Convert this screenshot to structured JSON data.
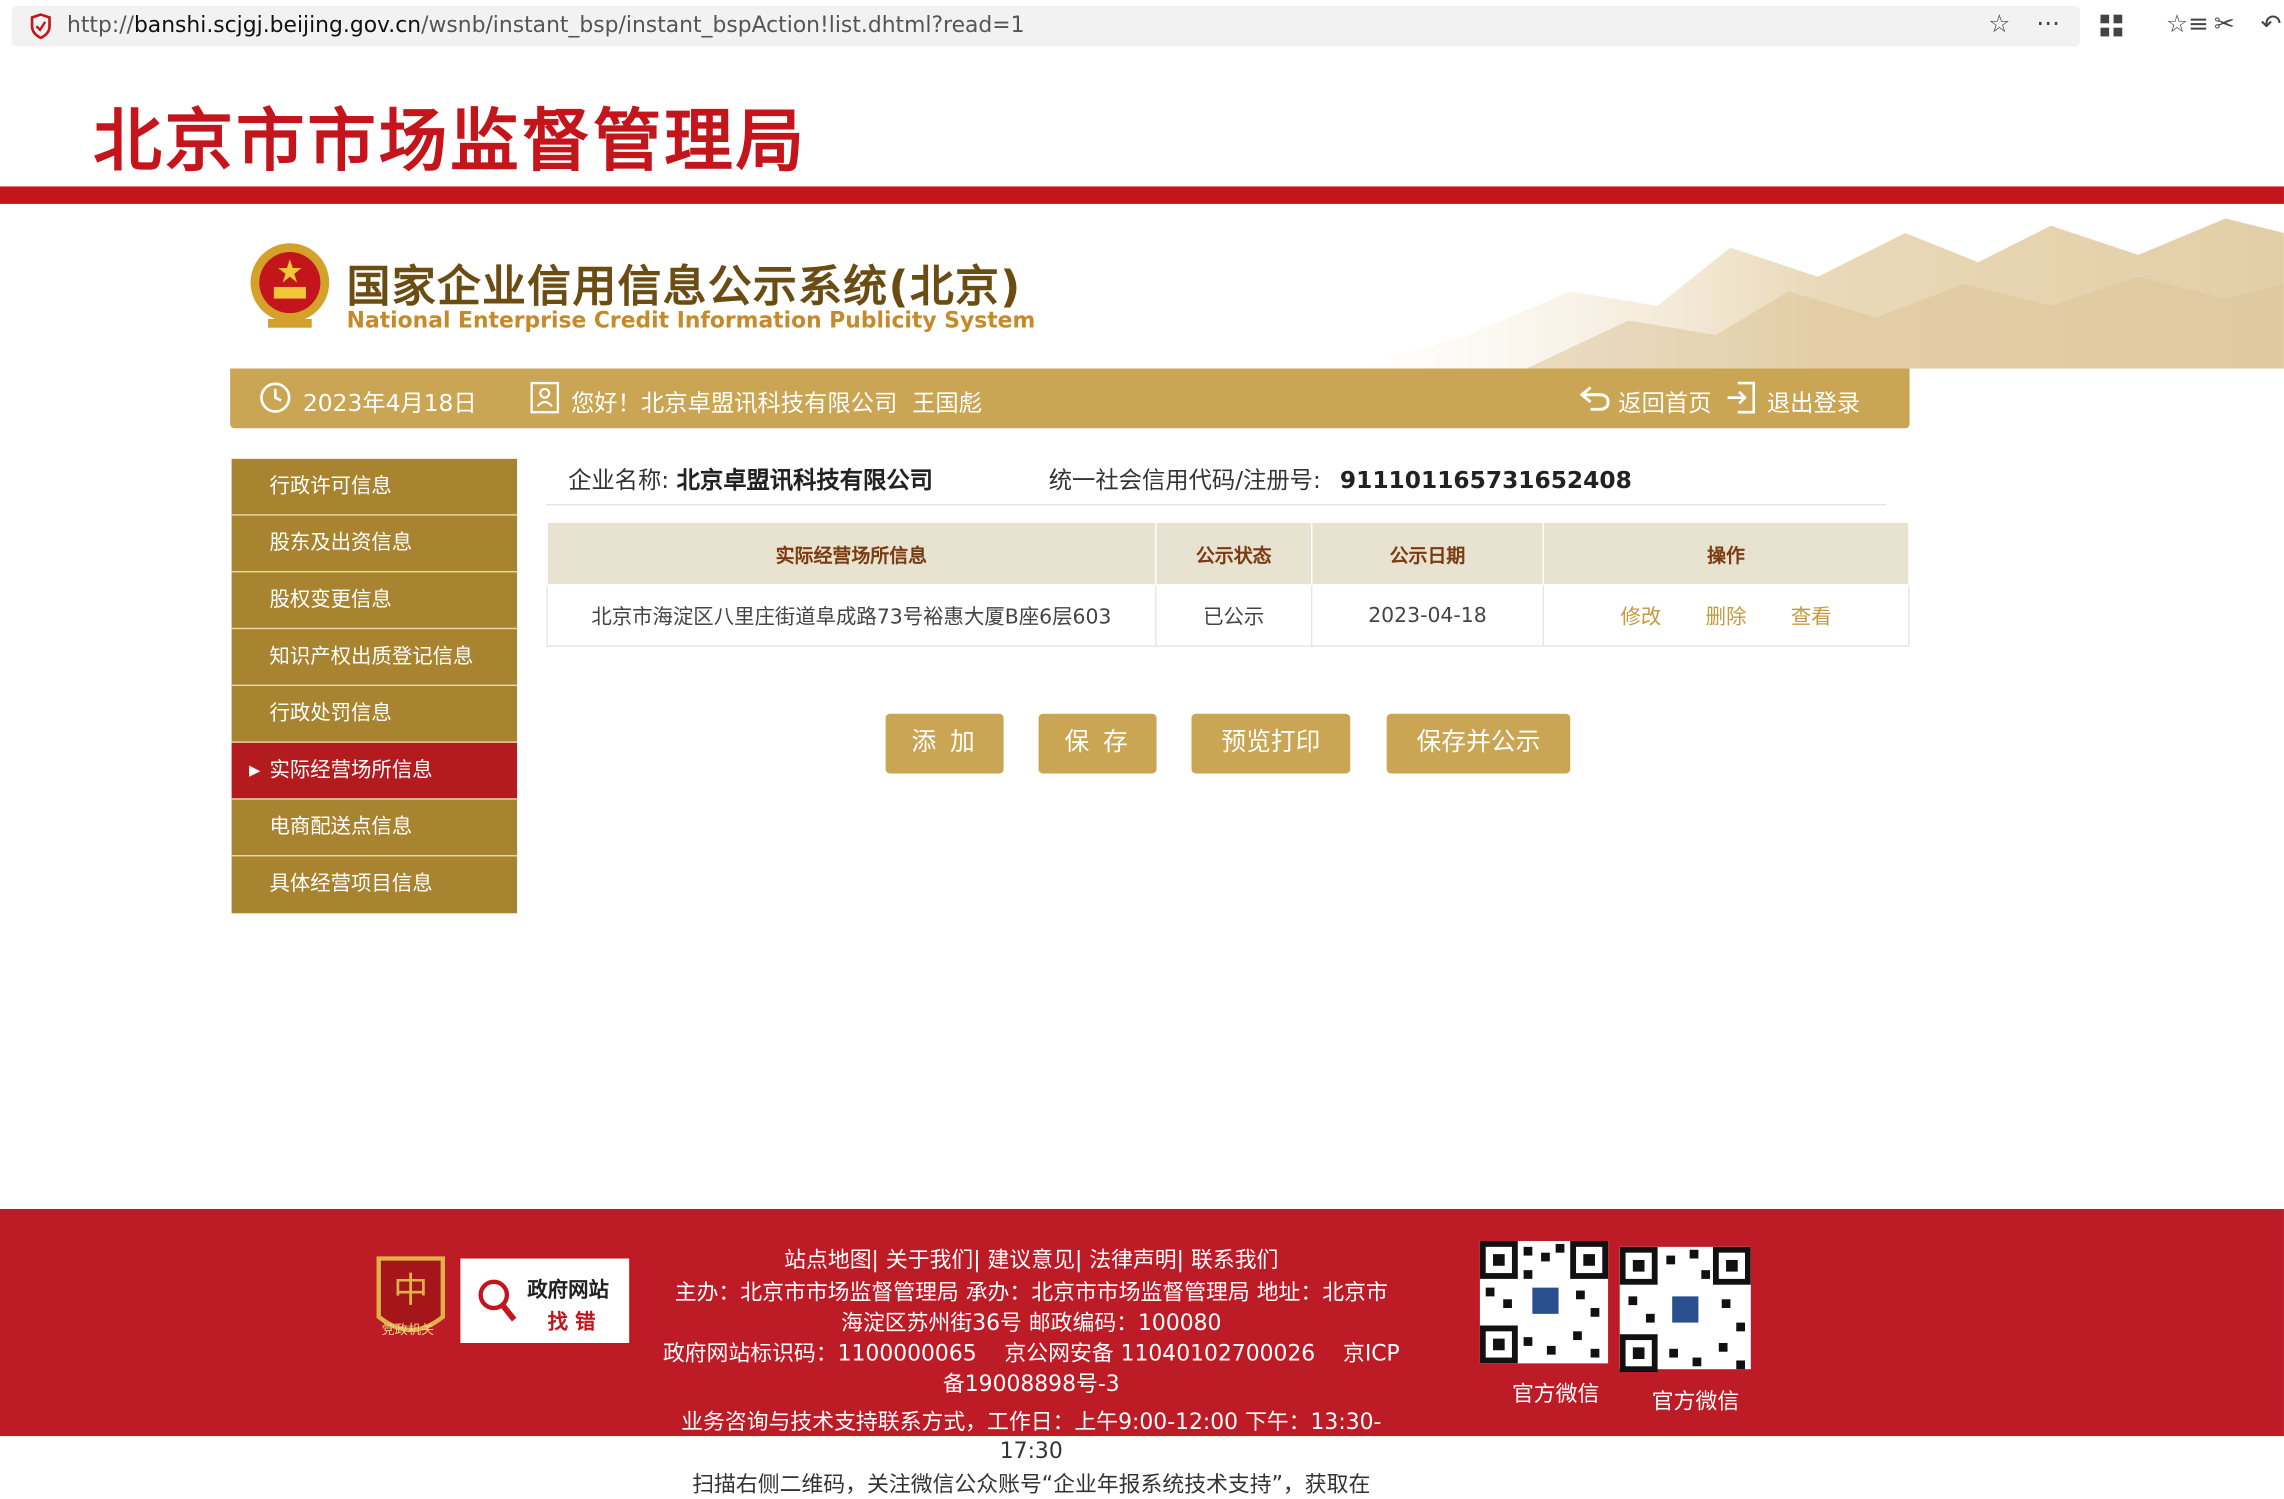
{
  "browser": {
    "url_prefix": "http://",
    "url_host": "banshi.scjgj.beijing.gov.cn",
    "url_path": "/wsnb/instant_bsp/instant_bspAction!list.dhtml?read=1"
  },
  "header": {
    "site_title": "北京市市场监督管理局"
  },
  "banner": {
    "system_name_cn": "国家企业信用信息公示系统(北京)",
    "system_name_en": "National Enterprise Credit Information Publicity System"
  },
  "infobar": {
    "date": "2023年4月18日",
    "greeting": "您好！北京卓盟讯科技有限公司  王国彪",
    "home_label": "返回首页",
    "logout_label": "退出登录"
  },
  "sidebar": {
    "items": [
      {
        "label": "行政许可信息"
      },
      {
        "label": "股东及出资信息"
      },
      {
        "label": "股权变更信息"
      },
      {
        "label": "知识产权出质登记信息"
      },
      {
        "label": "行政处罚信息"
      },
      {
        "label": "实际经营场所信息",
        "active": true
      },
      {
        "label": "电商配送点信息"
      },
      {
        "label": "具体经营项目信息"
      }
    ]
  },
  "company": {
    "name_label": "企业名称:",
    "name": "北京卓盟讯科技有限公司",
    "code_label": "统一社会信用代码/注册号:",
    "code": "911101165731652408"
  },
  "table": {
    "headers": [
      "实际经营场所信息",
      "公示状态",
      "公示日期",
      "操作"
    ],
    "rows": [
      {
        "address": "北京市海淀区八里庄街道阜成路73号裕惠大厦B座6层603",
        "status": "已公示",
        "date": "2023-04-18"
      }
    ],
    "actions": [
      "修改",
      "删除",
      "查看"
    ]
  },
  "buttons": {
    "add": "添 加",
    "save": "保 存",
    "preview": "预览打印",
    "save_publish": "保存并公示"
  },
  "footer": {
    "links": "站点地图| 关于我们| 建议意见| 法律声明| 联系我们",
    "line1": "主办：北京市市场监督管理局 承办：北京市市场监督管理局 地址：北京市",
    "line2": "海淀区苏州街36号 邮政编码：100080",
    "line3": "政府网站标识码：1100000065    京公网安备 11040102700026    京ICP",
    "line4": "备19008898号-3",
    "line5": "业务咨询与技术支持联系方式，工作日：上午9:00-12:00 下午：13:30-",
    "line6": "17:30",
    "line7": "扫描右侧二维码，关注微信公众账号“企业年报系统技术支持”，获取在",
    "party_badge": "党政机关",
    "gov_badge_top": "政府网站",
    "gov_badge_bottom": "找 错",
    "qr1_caption": "官方微信",
    "qr2_caption": "官方微信"
  },
  "colors": {
    "brand_red": "#c4151c",
    "gold": "#c9a554",
    "sidebar_gold": "#a88330",
    "sidebar_active": "#b31b1f",
    "footer_red": "#bd1b26"
  },
  "icons": [
    "shield-icon",
    "star-icon",
    "more-icon",
    "apps-icon",
    "favorites-icon",
    "tools-icon",
    "back-icon",
    "clock-icon",
    "user-card-icon",
    "home-return-icon",
    "logout-icon"
  ]
}
